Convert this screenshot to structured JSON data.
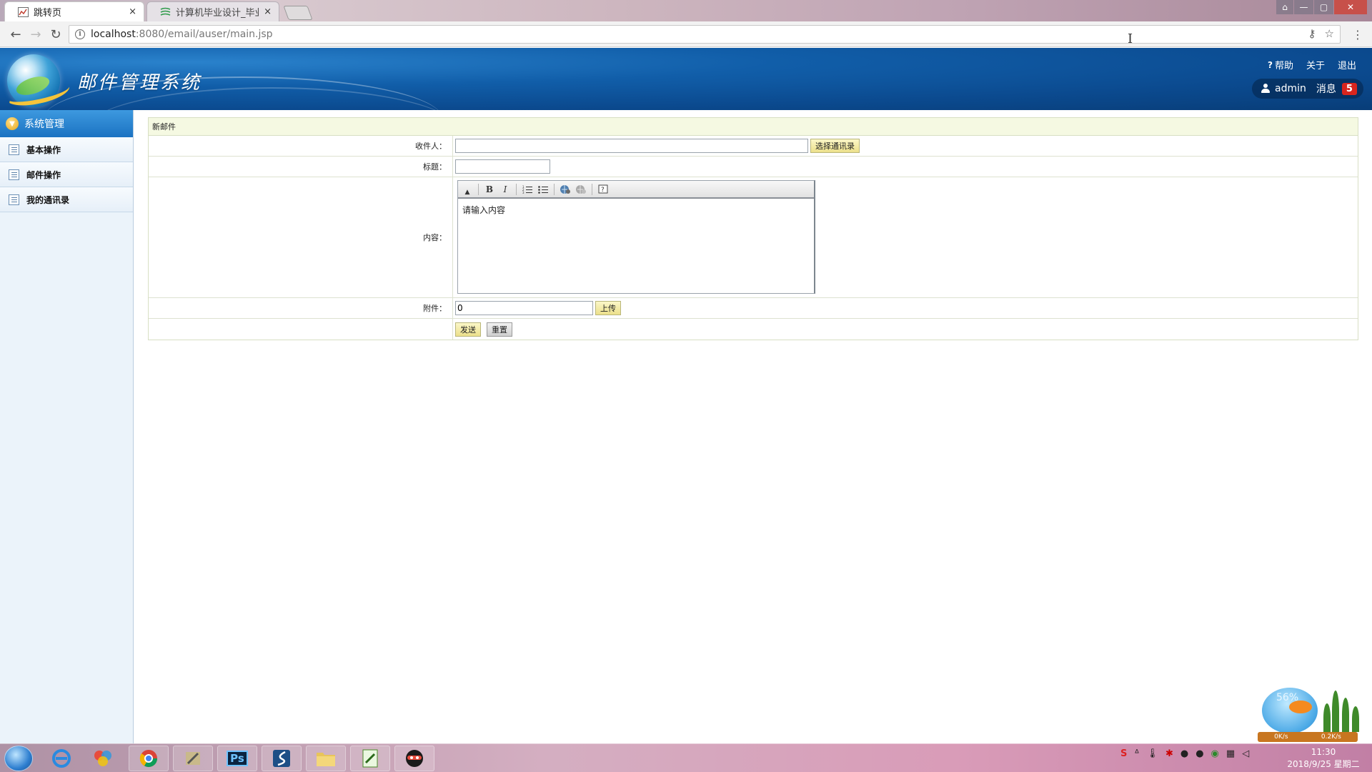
{
  "browser": {
    "tabs": [
      {
        "title": "跳转页",
        "active": true
      },
      {
        "title": "计算机毕业设计_毕业设计",
        "active": false
      }
    ],
    "close_glyph": "×",
    "url_host": "localhost",
    "url_rest": ":8080/email/auser/main.jsp"
  },
  "app": {
    "logo_text": "邮件管理系统",
    "header_links": {
      "help": "帮助",
      "about": "关于",
      "logout": "退出"
    },
    "user": {
      "name": "admin",
      "messages_label": "消息",
      "messages_count": "5"
    }
  },
  "sidebar": {
    "header": "系统管理",
    "items": [
      {
        "label": "基本操作"
      },
      {
        "label": "邮件操作"
      },
      {
        "label": "我的通讯录"
      }
    ]
  },
  "form": {
    "title": "新邮件",
    "recipient_label": "收件人：",
    "recipient_value": "",
    "select_contacts_button": "选择通讯录",
    "subject_label": "标题：",
    "subject_value": "",
    "content_label": "内容：",
    "content_placeholder": "请输入内容",
    "attachment_label": "附件：",
    "attachment_value": "0",
    "upload_button": "上传",
    "send_button": "发送",
    "reset_button": "重置"
  },
  "editor_toolbar": {
    "bold": "B",
    "italic": "I"
  },
  "taskbar": {
    "clock_time": "11:30",
    "clock_date": "2018/9/25 星期二"
  },
  "widget": {
    "percent": "56%",
    "down_speed": "0K/s",
    "up_speed": "0.2K/s"
  }
}
